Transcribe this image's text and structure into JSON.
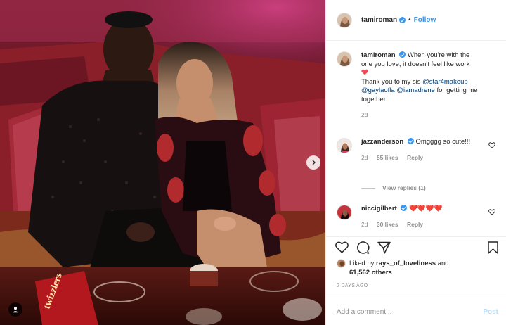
{
  "photo": {
    "alt": "Couple posing on a red couch",
    "box_label": "twizzlers",
    "next_icon": "chevron-right-icon",
    "tag_icon": "user-tag-icon"
  },
  "header": {
    "username": "tamiroman",
    "verified": true,
    "separator": "•",
    "follow_label": "Follow"
  },
  "caption": {
    "username": "tamiroman",
    "text_1": "When you're with the one you love, it doesn't feel like work",
    "text_2": "Thank you to my sis",
    "mention_1": "@star4makeup",
    "mention_2": "@gaylaofla",
    "mention_3": "@iamadrene",
    "text_3": "for getting me together.",
    "age": "2d"
  },
  "comments": [
    {
      "username": "jazzanderson",
      "text": "Omgggg so cute!!!",
      "age": "2d",
      "likes": "55 likes",
      "reply_label": "Reply",
      "view_replies": "View replies (1)"
    },
    {
      "username": "niccigilbert",
      "text": "❤️❤️❤️❤️",
      "age": "2d",
      "likes": "30 likes",
      "reply_label": "Reply"
    }
  ],
  "actions": {
    "liked_by_prefix": "Liked by",
    "liked_by_user": "rays_of_loveliness",
    "liked_by_and": "and",
    "others_count": "61,562 others",
    "time_ago": "2 DAYS AGO"
  },
  "add_comment": {
    "placeholder": "Add a comment...",
    "post_label": "Post"
  },
  "colors": {
    "accent_blue": "#3897f0",
    "mention": "#00376b",
    "muted": "#8e8e8e",
    "post_disabled": "#b2dffc",
    "heart": "#ed4956"
  }
}
